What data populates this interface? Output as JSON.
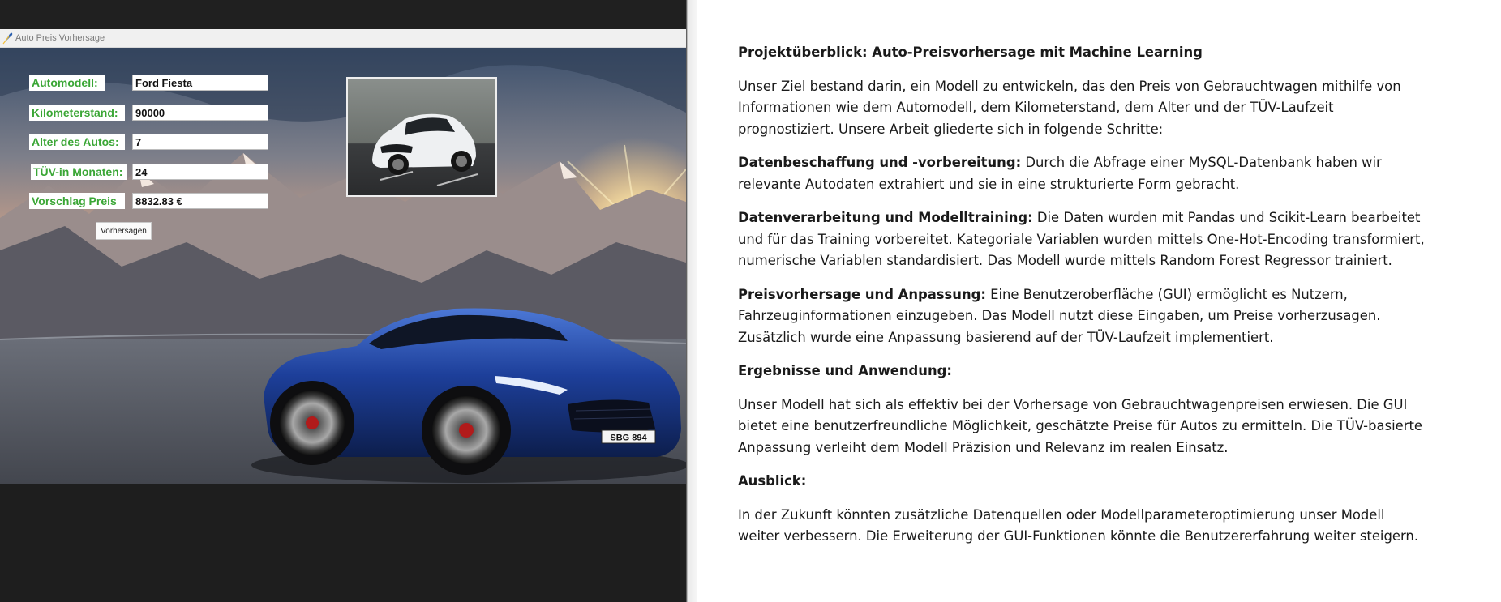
{
  "app": {
    "window_title": "Auto Preis Vorhersage",
    "form": {
      "model_label": "Automodell:",
      "model_value": "Ford Fiesta",
      "mileage_label": "Kilometerstand:",
      "mileage_value": "90000",
      "age_label": "Alter des Autos:",
      "age_value": "7",
      "tuev_label": "TÜV-in Monaten:",
      "tuev_value": "24",
      "price_label": "Vorschlag Preis",
      "price_value": "8832.83 €",
      "predict_button": "Vorhersagen"
    },
    "license_plate": "SBG 894",
    "colors": {
      "label_green": "#3aa635",
      "car_blue": "#1d3f9a"
    }
  },
  "document": {
    "heading": "Projektüberblick: Auto-Preisvorhersage mit Machine Learning",
    "intro": "Unser Ziel bestand darin, ein Modell zu entwickeln, das den Preis von Gebrauchtwagen mithilfe von Informationen wie dem Automodell, dem Kilometerstand, dem Alter und der TÜV-Laufzeit prognostiziert. Unsere Arbeit gliederte sich in folgende Schritte:",
    "step1_title": "Datenbeschaffung und -vorbereitung:",
    "step1_text": " Durch die Abfrage einer MySQL-Datenbank haben wir relevante Autodaten extrahiert und sie in eine strukturierte Form gebracht.",
    "step2_title": "Datenverarbeitung und Modelltraining:",
    "step2_text": " Die Daten wurden mit Pandas und Scikit-Learn bearbeitet und für das Training vorbereitet. Kategoriale Variablen wurden mittels One-Hot-Encoding transformiert, numerische Variablen standardisiert. Das Modell wurde mittels Random Forest Regressor trainiert.",
    "step3_title": "Preisvorhersage und Anpassung:",
    "step3_text": " Eine Benutzeroberfläche (GUI) ermöglicht es Nutzern, Fahrzeuginformationen einzugeben. Das Modell nutzt diese Eingaben, um Preise vorherzusagen. Zusätzlich wurde eine Anpassung basierend auf der TÜV-Laufzeit implementiert.",
    "results_heading": "Ergebnisse und Anwendung:",
    "results_text": "Unser Modell hat sich als effektiv bei der Vorhersage von Gebrauchtwagenpreisen erwiesen. Die GUI bietet eine benutzerfreundliche Möglichkeit, geschätzte Preise für Autos zu ermitteln. Die TÜV-basierte Anpassung verleiht dem Modell Präzision und Relevanz im realen Einsatz.",
    "outlook_heading": "Ausblick:",
    "outlook_text": "In der Zukunft könnten zusätzliche Datenquellen oder Modellparameteroptimierung unser Modell weiter verbessern. Die Erweiterung der GUI-Funktionen könnte die Benutzererfahrung weiter steigern."
  }
}
